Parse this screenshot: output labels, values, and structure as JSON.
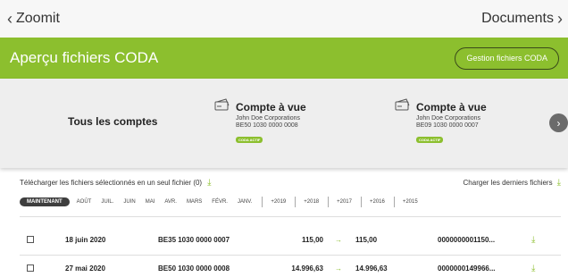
{
  "topbar": {
    "back_label": "Zoomit",
    "next_label": "Documents"
  },
  "header": {
    "title": "Aperçu fichiers CODA",
    "manage_button": "Gestion fichiers CODA"
  },
  "accounts": {
    "all_label": "Tous les comptes",
    "items": [
      {
        "name": "Compte à vue",
        "owner": "John Doe Corporations",
        "iban": "BE50 1030 0000 0008",
        "badge": "CODA ACTIF"
      },
      {
        "name": "Compte à vue",
        "owner": "John Doe Corporations",
        "iban": "BE09 1030 0000 0007",
        "badge": "CODA ACTIF"
      }
    ]
  },
  "actions": {
    "download_selected": "Télécharger les fichiers sélectionnés en un seul fichier (0)",
    "load_latest": "Charger les derniers fichiers"
  },
  "filters": {
    "active": "MAINTENANT",
    "months": [
      "AOÛT",
      "JUIL.",
      "JUIN",
      "MAI",
      "AVR.",
      "MARS",
      "FÉVR.",
      "JANV."
    ],
    "years": [
      "+2019",
      "+2018",
      "+2017",
      "+2016",
      "+2015"
    ]
  },
  "rows": [
    {
      "date": "18 juin 2020",
      "account": "BE35 1030 0000 0007",
      "amount_from": "115,00",
      "amount_to": "115,00",
      "reference": "0000000001150..."
    },
    {
      "date": "27 mai 2020",
      "account": "BE50 1030 0000 0008",
      "amount_from": "14.996,63",
      "amount_to": "14.996,63",
      "reference": "0000000149966..."
    }
  ],
  "colors": {
    "brand_green": "#8cbf2e",
    "chip_dark": "#3e3e3e"
  },
  "icons": {
    "back": "chevron-left-icon",
    "next": "chevron-right-icon",
    "card": "card-icon",
    "download": "download-icon"
  }
}
